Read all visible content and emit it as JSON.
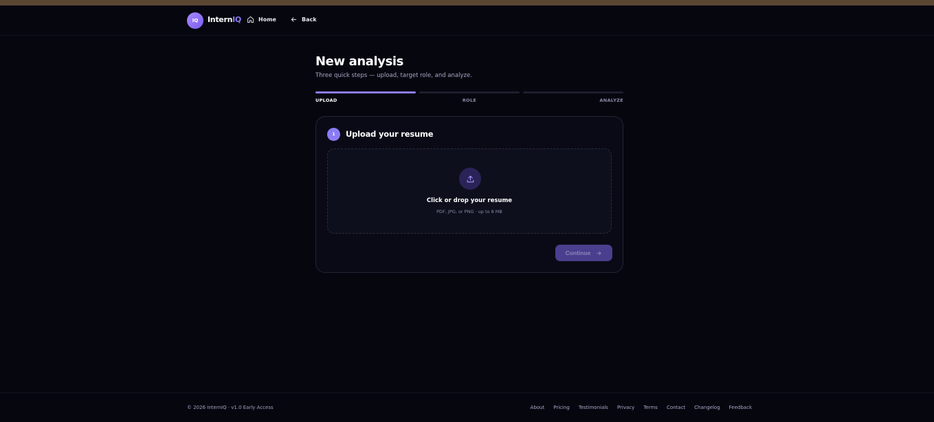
{
  "nav": {
    "logo_text": "IQ",
    "brand_part1": "Intern",
    "brand_part2": "IQ",
    "home_label": "Home",
    "back_label": "Back"
  },
  "page": {
    "title": "New analysis",
    "subtitle": "Three quick steps — upload, target role, and analyze."
  },
  "steps": [
    {
      "label": "UPLOAD",
      "active": true
    },
    {
      "label": "ROLE",
      "active": false
    },
    {
      "label": "ANALYZE",
      "active": false
    }
  ],
  "card": {
    "step_number": "1",
    "title": "Upload your resume",
    "dropzone_title": "Click or drop your resume",
    "dropzone_hint": "PDF, JPG, or PNG · up to 8 MB",
    "continue_label": "Continue"
  },
  "footer": {
    "copyright": "© 2026 InternIQ · v1.0 Early Access",
    "links": [
      "About",
      "Pricing",
      "Testimonials",
      "Privacy",
      "Terms",
      "Contact",
      "Changelog",
      "Feedback"
    ]
  },
  "colors": {
    "accent": "#8b7cf6",
    "background": "#06060f",
    "card": "#0a0a16",
    "button_disabled": "#4a3f8e"
  },
  "icons": {
    "home": "home-icon",
    "back": "arrow-left-icon",
    "upload": "upload-icon",
    "continue": "arrow-right-icon"
  }
}
